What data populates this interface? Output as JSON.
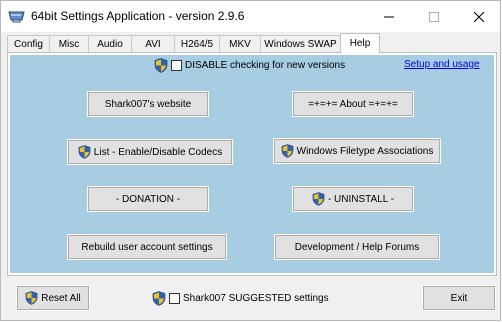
{
  "window": {
    "title": "64bit Settings Application - version 2.9.6"
  },
  "tabs": [
    {
      "label": "Config"
    },
    {
      "label": "Misc"
    },
    {
      "label": "Audio"
    },
    {
      "label": "AVI"
    },
    {
      "label": "H264/5"
    },
    {
      "label": "MKV"
    },
    {
      "label": "Windows SWAP"
    },
    {
      "label": "Help",
      "active": true
    }
  ],
  "help": {
    "disable_check_label": "DISABLE checking for new versions",
    "setup_link": "Setup and usage",
    "website_button": "Shark007's website",
    "about_button": "=+=+= About =+=+=",
    "codecs_button": "List - Enable/Disable Codecs",
    "filetype_button": "Windows Filetype Associations",
    "donation_button": "- DONATION -",
    "uninstall_button": "- UNINSTALL -",
    "rebuild_button": "Rebuild user account settings",
    "forums_button": "Development / Help Forums"
  },
  "footer": {
    "reset_button": "Reset All",
    "suggested_label": "Shark007 SUGGESTED settings",
    "exit_button": "Exit"
  },
  "colors": {
    "panel_bg": "#a7cde2",
    "button_bg": "#e1e1e1",
    "link": "#0000ee"
  },
  "icons": {
    "app": "app-icon",
    "uac_shield": "uac-shield-icon"
  }
}
